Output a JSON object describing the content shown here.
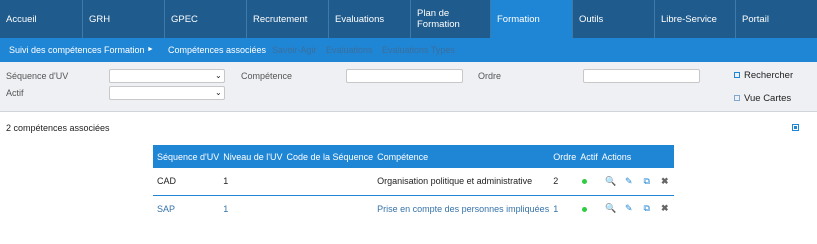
{
  "nav": {
    "items": [
      {
        "label": "Accueil"
      },
      {
        "label": "GRH"
      },
      {
        "label": "GPEC"
      },
      {
        "label": "Recrutement"
      },
      {
        "label": "Evaluations"
      },
      {
        "label": "Plan de Formation"
      },
      {
        "label": "Formation"
      },
      {
        "label": "Outils"
      },
      {
        "label": "Libre-Service"
      },
      {
        "label": "Portail"
      }
    ],
    "active": "Formation",
    "colors": {
      "bar": "#1f5b8c",
      "active": "#1f86d6"
    }
  },
  "subnav": {
    "items": [
      {
        "label": "Suivi des compétences Formation"
      },
      {
        "label": "Compétences associées"
      },
      {
        "label": "Savoir-Agir"
      },
      {
        "label": "Evaluations"
      },
      {
        "label": "Evaluations Types"
      }
    ],
    "arrow_icon": "chevron-right-icon"
  },
  "filters": {
    "sequence_label": "Séquence d'UV",
    "sequence_value": "",
    "actif_label": "Actif",
    "actif_value": "",
    "competence_label": "Compétence",
    "competence_value": "",
    "ordre_label": "Ordre",
    "ordre_value": "",
    "rechercher_label": "Rechercher",
    "vue_cartes_label": "Vue Cartes"
  },
  "results": {
    "count_text": "2 compétences associées",
    "export_icon": "export-icon"
  },
  "table": {
    "columns": [
      "Séquence d'UV",
      "Niveau de l'UV",
      "Code de la Séquence",
      "Compétence",
      "Ordre",
      "Actif",
      "Actions"
    ],
    "rows": [
      {
        "sequence": "CAD",
        "niveau": "1",
        "code": "",
        "competence": "Organisation politique et administrative",
        "ordre": "2",
        "actif": true
      },
      {
        "sequence": "SAP",
        "niveau": "1",
        "code": "",
        "competence": "Prise en compte des personnes impliquées",
        "ordre": "1",
        "actif": true
      }
    ],
    "action_icons": {
      "view": "🔍",
      "edit": "✎",
      "copy": "⧉",
      "delete": "✖"
    },
    "action_icon_names": [
      "search-icon",
      "edit-icon",
      "copy-icon",
      "delete-icon"
    ],
    "active_color": "#2ecc40"
  }
}
